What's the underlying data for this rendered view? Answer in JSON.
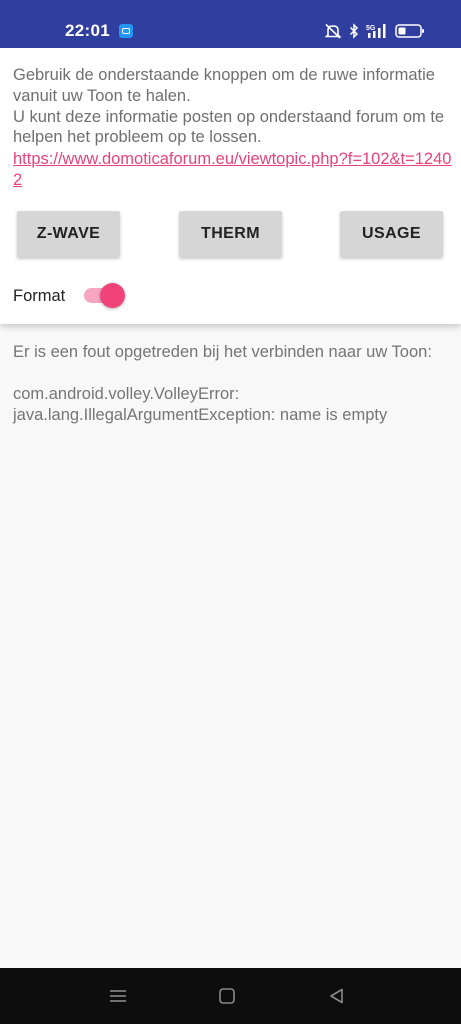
{
  "status_bar": {
    "time": "22:01",
    "icons": [
      "app-notification-icon",
      "mute-icon",
      "bluetooth-icon",
      "5g-signal-icon",
      "battery-icon"
    ],
    "background_color": "#303f9f"
  },
  "info": {
    "intro_text": "Gebruik de onderstaande knoppen om de ruwe informatie vanuit uw Toon te halen.\nU kunt deze informatie posten op onderstaand forum om te helpen het probleem op te lossen.",
    "link": "https://www.domoticaforum.eu/viewtopic.php?f=102&t=12402"
  },
  "buttons": {
    "zwave": "Z-WAVE",
    "therm": "THERM",
    "usage": "USAGE"
  },
  "format": {
    "label": "Format",
    "enabled": true,
    "accent_color": "#f0437a"
  },
  "output": {
    "error_text": "Er is een fout opgetreden bij het verbinden naar uw Toon:\n\ncom.android.volley.VolleyError: java.lang.IllegalArgumentException: name is empty"
  },
  "nav_bar": {
    "icons": [
      "menu-icon",
      "home-icon",
      "back-icon"
    ]
  }
}
